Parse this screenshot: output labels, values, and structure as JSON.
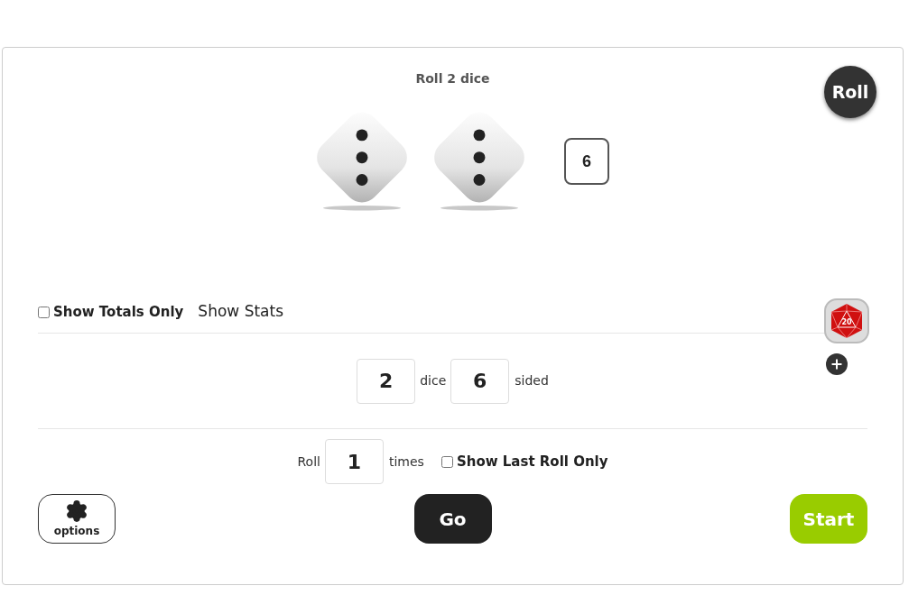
{
  "title": "Roll 2 dice",
  "roll_button": "Roll",
  "dice": [
    {
      "kind": "three"
    },
    {
      "kind": "three"
    }
  ],
  "total": "6",
  "show_totals_only": {
    "label": "Show Totals Only",
    "checked": false
  },
  "show_stats": "Show Stats",
  "dice_count": {
    "value": "2",
    "label": "dice"
  },
  "sides": {
    "value": "6",
    "label": "sided"
  },
  "d20_badge": "20",
  "roll_prefix": "Roll",
  "times": {
    "value": "1",
    "label": "times"
  },
  "show_last_roll_only": {
    "label": "Show Last Roll Only",
    "checked": false
  },
  "options_button": "options",
  "go_button": "Go",
  "start_button": "Start"
}
